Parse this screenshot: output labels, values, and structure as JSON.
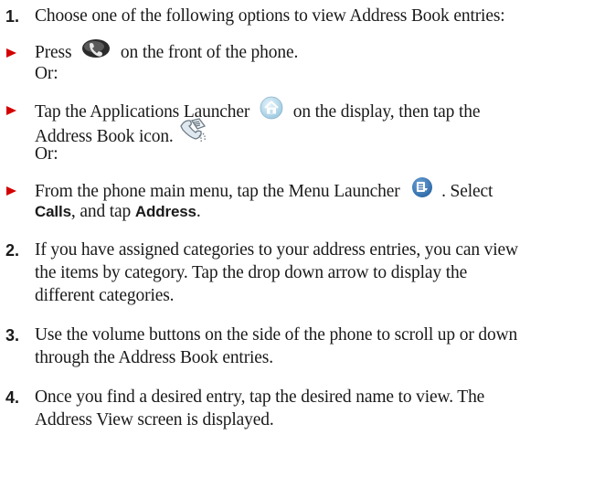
{
  "steps": [
    {
      "number": "1.",
      "text": "Choose one of the following options to view Address Book entries:"
    },
    {
      "number": "2.",
      "lines": [
        "If you have assigned categories to your address entries, you can view",
        "the items by category. Tap the drop down arrow to display the",
        "different categories."
      ]
    },
    {
      "number": "3.",
      "lines": [
        "Use the volume buttons on the side of the phone to scroll up or down",
        "through the Address Book entries."
      ]
    },
    {
      "number": "4.",
      "lines": [
        "Once you find a desired entry, tap the desired name to view. The",
        "Address View screen is displayed."
      ]
    }
  ],
  "options": [
    {
      "before": "Press",
      "after": "on the front of the phone.",
      "icon": "phone-key-icon"
    },
    {
      "before": "Tap the Applications Launcher",
      "after": "on the display, then tap the",
      "line2": "Address Book icon.",
      "icon": "home-launcher-icon",
      "icon2": "address-book-icon"
    },
    {
      "before": "From the phone main menu, tap the Menu Launcher",
      "after": ". Select",
      "bold1": "Calls",
      "mid": ", and tap",
      "bold2": "Address",
      "end": ".",
      "icon": "menu-launcher-icon"
    }
  ],
  "or_label": "Or:",
  "colors": {
    "bullet": "#d40000",
    "text": "#1a1a1a"
  }
}
